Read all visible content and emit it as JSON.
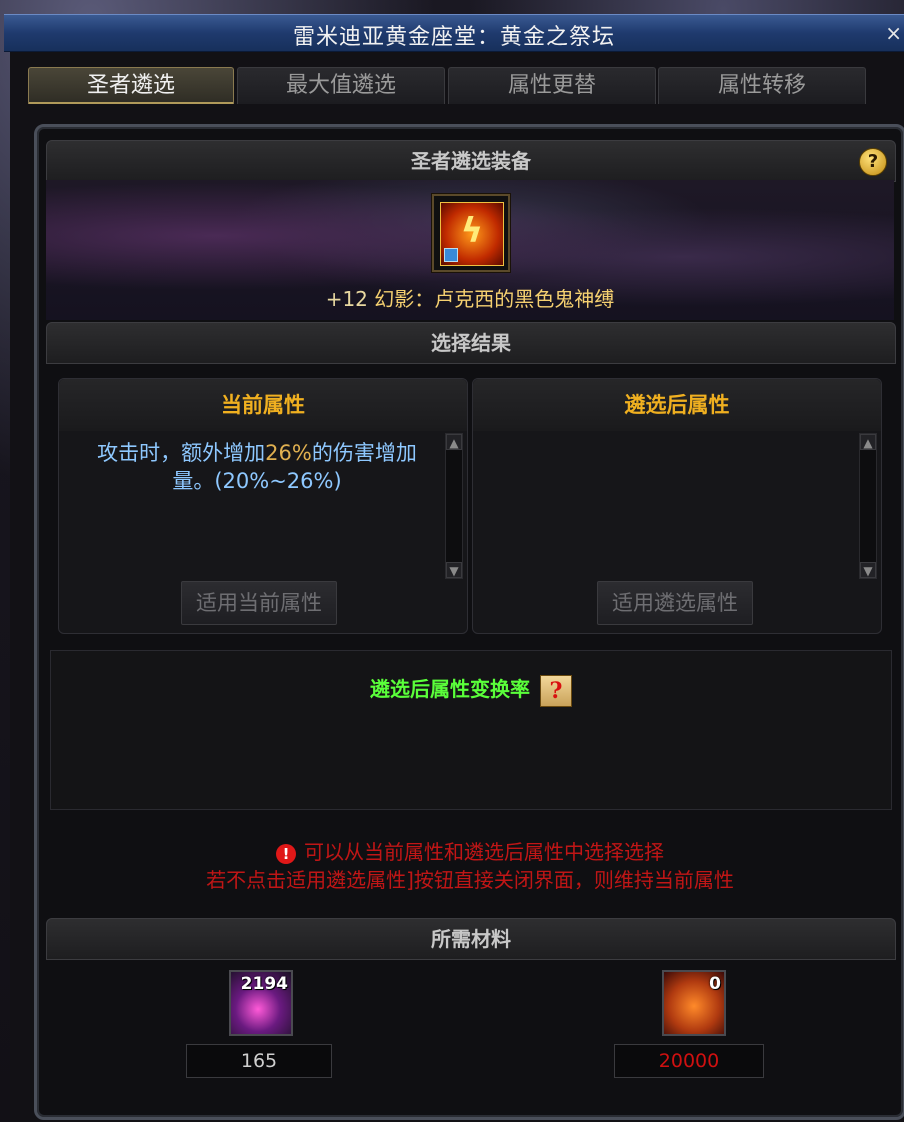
{
  "window": {
    "title": "雷米迪亚黄金座堂：黄金之祭坛",
    "close_symbol": "×"
  },
  "tabs": [
    {
      "label": "圣者遴选",
      "active": true
    },
    {
      "label": "最大值遴选",
      "active": false
    },
    {
      "label": "属性更替",
      "active": false
    },
    {
      "label": "属性转移",
      "active": false
    }
  ],
  "equip_section": {
    "title": "圣者遴选装备",
    "help_symbol": "?"
  },
  "item": {
    "enhance": "+12",
    "name": "幻影：卢克西的黑色鬼神缚"
  },
  "result_section": {
    "title": "选择结果"
  },
  "current": {
    "title": "当前属性",
    "text_before": "攻击时，额外增加",
    "highlight": "26%",
    "text_after": "的伤害增加量。(20%~26%)",
    "button": "适用当前属性"
  },
  "after": {
    "title": "遴选后属性",
    "button": "适用遴选属性"
  },
  "conversion": {
    "title": "遴选后属性变换率"
  },
  "warning": {
    "line1": "可以从当前属性和遴选后属性中选择选择",
    "line2": "若不点击适用遴选属性]按钮直接关闭界面，则维持当前属性"
  },
  "materials_section": {
    "title": "所需材料"
  },
  "materials": [
    {
      "icon": "purple-orb-icon",
      "count": "2194",
      "required": "165"
    },
    {
      "icon": "gold-coin-icon",
      "count": "0",
      "required": "20000"
    }
  ],
  "colors": {
    "accent_gold": "#f0b020",
    "text_blue": "#8ec8ff",
    "warning_red": "#c01616",
    "green": "#5aff3a"
  }
}
